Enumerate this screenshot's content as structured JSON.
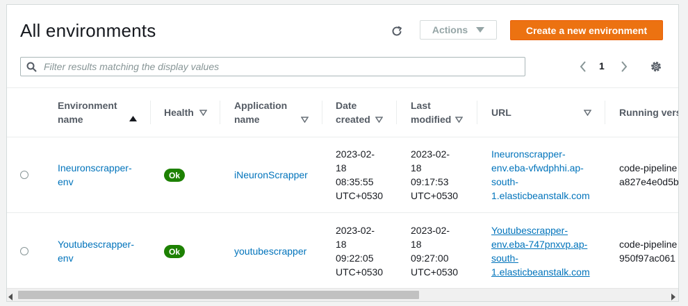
{
  "header": {
    "title": "All environments",
    "actions_label": "Actions",
    "create_label": "Create a new environment"
  },
  "search": {
    "placeholder": "Filter results matching the display values"
  },
  "pagination": {
    "current_page": "1"
  },
  "table": {
    "columns": {
      "environment_name": "Environment name",
      "health": "Health",
      "application_name": "Application name",
      "date_created": "Date created",
      "last_modified": "Last modified",
      "url": "URL",
      "running_version": "Running vers"
    },
    "rows": [
      {
        "environment_name": "Ineuronscrapper-\nenv",
        "health": "Ok",
        "application_name": "iNeuronScrapper",
        "date_created": "2023-02-\n18\n08:35:55\nUTC+0530",
        "last_modified": "2023-02-\n18\n09:17:53\nUTC+0530",
        "url": "Ineuronscrapper-\nenv.eba-vfwdphhi.ap-\nsouth-\n1.elasticbeanstalk.com",
        "running_version": "code-pipeline\na827e4e0d5b"
      },
      {
        "environment_name": "Youtubescrapper-\nenv",
        "health": "Ok",
        "application_name": "youtubescrapper",
        "date_created": "2023-02-\n18\n09:22:05\nUTC+0530",
        "last_modified": "2023-02-\n18\n09:27:00\nUTC+0530",
        "url": "Youtubescrapper-\nenv.eba-747pnxvp.ap-\nsouth-\n1.elasticbeanstalk.com",
        "running_version": "code-pipeline\n950f97ac061"
      }
    ]
  },
  "colors": {
    "accent": "#ec7211",
    "link": "#0073bb",
    "ok_badge": "#1d8102",
    "header_text": "#545b64"
  }
}
